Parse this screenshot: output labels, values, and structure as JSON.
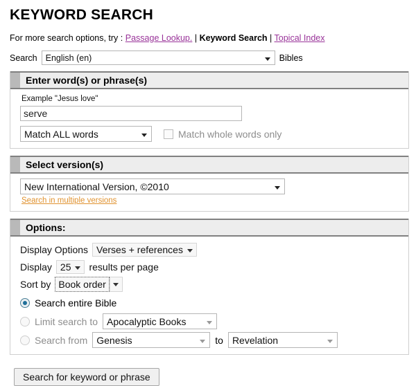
{
  "header": {
    "title": "KEYWORD SEARCH",
    "subnav_prefix": "For more search options, try :",
    "link_passage_lookup": "Passage Lookup.",
    "separator": "|",
    "current_page": "Keyword Search",
    "link_topical_index": "Topical Index"
  },
  "language_row": {
    "label": "Search",
    "selected_language": "English (en)",
    "suffix": "Bibles"
  },
  "section_words": {
    "heading": "Enter word(s) or phrase(s)",
    "example_hint": "Example \"Jesus love\"",
    "keyword_value": "serve",
    "keyword_placeholder": "",
    "match_mode": "Match ALL words",
    "whole_words_label": "Match whole words only",
    "whole_words_checked": false
  },
  "section_version": {
    "heading": "Select version(s)",
    "selected_version": "New International Version, ©2010",
    "multiple_versions_link": "Search in multiple versions"
  },
  "section_options": {
    "heading": "Options:",
    "display_options_label": "Display Options",
    "display_options_value": "Verses + references",
    "display_label": "Display",
    "results_per_page_value": "25",
    "results_per_page_suffix": "results per page",
    "sort_by_label": "Sort by",
    "sort_by_value": "Book order",
    "scope_entire_label": "Search entire Bible",
    "scope_limit_label": "Limit search to",
    "scope_limit_value": "Apocalyptic Books",
    "scope_range_label": "Search from",
    "scope_range_from": "Genesis",
    "scope_range_to_word": "to",
    "scope_range_to": "Revelation"
  },
  "submit": {
    "label": "Search for keyword or phrase"
  },
  "colors": {
    "link_visited": "#993399",
    "link_orange": "#e0922f",
    "radio_selected": "#1f6f99",
    "header_bar": "#ededed",
    "header_accent": "#b9b9b9",
    "disabled_text": "#8d8d8d"
  }
}
